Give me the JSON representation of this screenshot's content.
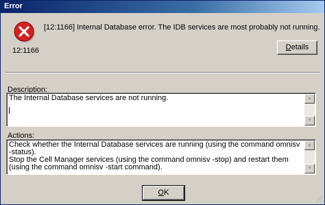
{
  "window": {
    "title": "Error"
  },
  "error": {
    "icon": "error-icon",
    "code": "12:1166",
    "message": "[12:1166] Internal Database error. The IDB services are most probably not running."
  },
  "buttons": {
    "details_pre": "",
    "details_mnemonic": "D",
    "details_post": "etails",
    "ok_pre": "",
    "ok_mnemonic": "O",
    "ok_post": "K"
  },
  "description": {
    "label": "Description:",
    "text": "The Internal Database services are not running."
  },
  "actions": {
    "label": "Actions:",
    "text": "Check whether the Internal Database services are running (using the command omnisv -status).\nStop the Cell Manager services (using the command omnisv -stop) and restart them\n(using the command omnisv -start command)."
  },
  "colors": {
    "titlebar": "#0a246a",
    "error_red": "#d32020",
    "face": "#d4d0c8"
  }
}
